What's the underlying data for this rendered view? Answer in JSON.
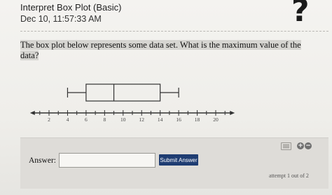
{
  "header": {
    "title": "Interpret Box Plot (Basic)",
    "timestamp": "Dec 10, 11:57:33 AM",
    "help_symbol": "?"
  },
  "question": {
    "text": "The box plot below represents some data set. What is the maximum value of the data?"
  },
  "chart_data": {
    "type": "box",
    "axis_ticks": [
      2,
      4,
      6,
      8,
      10,
      12,
      14,
      16,
      18,
      20
    ],
    "axis_range": [
      1,
      21
    ],
    "box": {
      "min": 4,
      "q1": 6,
      "median": 9,
      "q3": 14,
      "max": 16
    }
  },
  "answer": {
    "label": "Answer:",
    "input_value": "",
    "submit_label": "Submit Answer"
  },
  "footer": {
    "attempt_text": "attempt 1 out of 2"
  },
  "icons": {
    "keyboard": "keyboard-icon",
    "add": "plus-circle-icon",
    "remove": "minus-circle-icon",
    "add_symbol": "+",
    "remove_symbol": "−"
  },
  "colors": {
    "submit_button": "#1f3d72",
    "plot_stroke": "#333333"
  }
}
